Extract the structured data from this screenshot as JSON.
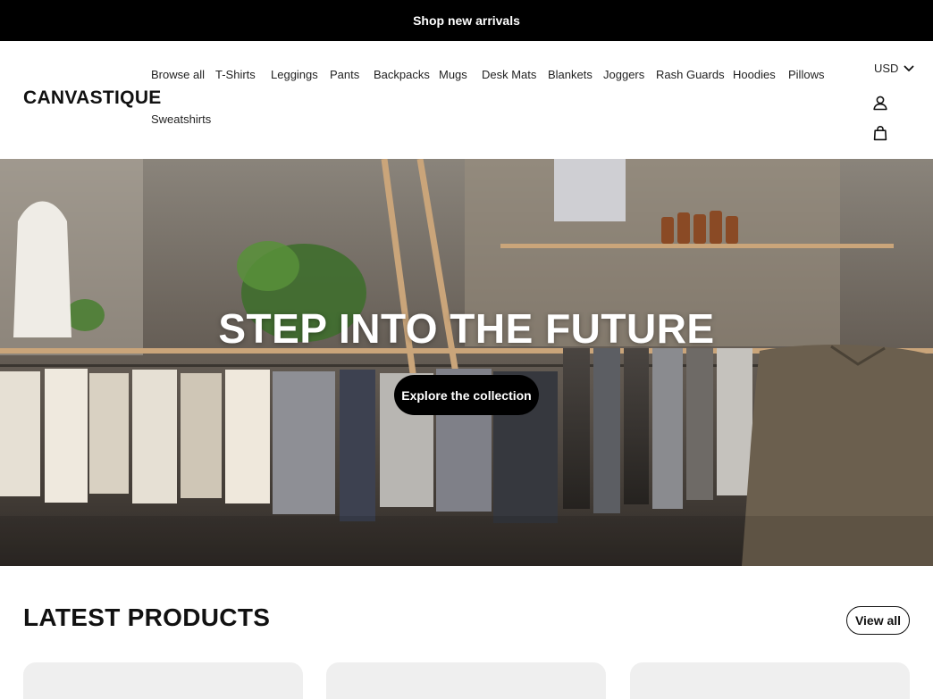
{
  "announcement": {
    "label": "Shop new arrivals"
  },
  "header": {
    "logo": "CANVASTIQUE",
    "nav": [
      "Browse all",
      "T-Shirts",
      "Leggings",
      "Pants",
      "Backpacks",
      "Mugs",
      "Desk Mats",
      "Blankets",
      "Joggers",
      "Rash Guards",
      "Hoodies",
      "Pillows",
      "Sweatshirts"
    ],
    "currency": "USD",
    "icons": {
      "account": "user-icon",
      "cart": "shopping-bag-icon",
      "currency_caret": "chevron-down-icon"
    }
  },
  "hero": {
    "title": "STEP INTO THE FUTURE",
    "button_label": "Explore the collection"
  },
  "products": {
    "title": "LATEST PRODUCTS",
    "view_all_label": "View all",
    "card_count": 3
  },
  "colors": {
    "black": "#000000",
    "white": "#ffffff",
    "card_bg": "#efefef"
  }
}
